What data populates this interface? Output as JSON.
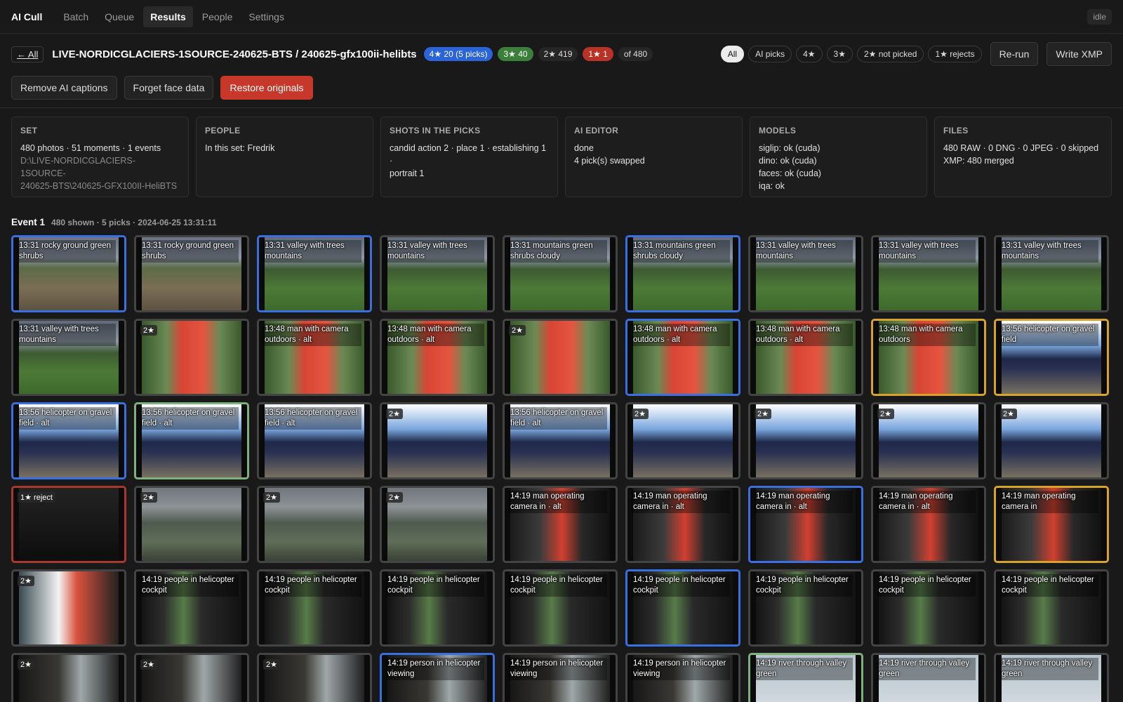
{
  "nav": {
    "brand": "AI Cull",
    "tabs": [
      "Batch",
      "Queue",
      "Results",
      "People",
      "Settings"
    ],
    "active_tab": "Results",
    "status": "idle"
  },
  "header": {
    "back": "← All",
    "title": "LIVE-NORDICGLACIERS-1SOURCE-240625-BTS / 240625-gfx100ii-helibts",
    "counts": {
      "four_star": "4★ 20 (5 picks)",
      "three_star": "3★ 40",
      "two_star": "2★ 419",
      "one_star": "1★ 1",
      "total": "of 480"
    },
    "filters": [
      "All",
      "AI picks",
      "4★",
      "3★",
      "2★ not picked",
      "1★ rejects"
    ],
    "rerun": "Re-run",
    "write_xmp": "Write XMP"
  },
  "actions": {
    "remove_captions": "Remove AI captions",
    "forget_faces": "Forget face data",
    "restore": "Restore originals"
  },
  "panels": [
    {
      "title": "SET",
      "lines": [
        "480 photos · 51 moments · 1 events"
      ],
      "dim_lines": [
        "D:\\LIVE-NORDICGLACIERS-1SOURCE-",
        "240625-BTS\\240625-GFX100II-HeliBTS"
      ]
    },
    {
      "title": "PEOPLE",
      "lines": [
        "In this set: Fredrik"
      ],
      "dim_lines": []
    },
    {
      "title": "SHOTS IN THE PICKS",
      "lines": [
        "candid action 2 · place 1 · establishing 1 ·",
        "portrait 1"
      ],
      "dim_lines": []
    },
    {
      "title": "AI EDITOR",
      "lines": [
        "done",
        "4 pick(s) swapped"
      ],
      "dim_lines": []
    },
    {
      "title": "MODELS",
      "lines": [
        "siglip: ok (cuda)",
        "dino: ok (cuda)",
        "faces: ok (cuda)",
        "iqa: ok"
      ],
      "dim_lines": []
    },
    {
      "title": "FILES",
      "lines": [
        "480 RAW · 0 DNG · 0 JPEG · 0 skipped",
        "XMP: 480 merged"
      ],
      "dim_lines": []
    }
  ],
  "event": {
    "title": "Event 1",
    "meta": "480 shown · 5 picks · 2024-06-25 13:31:11"
  },
  "thumbnails": [
    {
      "caption": "13:31 rocky ground green shrubs",
      "badge": "",
      "border": "pick",
      "img": "rocky"
    },
    {
      "caption": "13:31 rocky ground green shrubs",
      "badge": "",
      "border": "",
      "img": "rocky"
    },
    {
      "caption": "13:31 valley with trees mountains",
      "badge": "",
      "border": "pick",
      "img": "valley"
    },
    {
      "caption": "13:31 valley with trees mountains",
      "badge": "",
      "border": "",
      "img": "valley"
    },
    {
      "caption": "13:31 mountains green shrubs cloudy",
      "badge": "",
      "border": "",
      "img": "valley"
    },
    {
      "caption": "13:31 mountains green shrubs cloudy",
      "badge": "",
      "border": "pick",
      "img": "valley"
    },
    {
      "caption": "13:31 valley with trees mountains",
      "badge": "",
      "border": "",
      "img": "valley"
    },
    {
      "caption": "13:31 valley with trees mountains",
      "badge": "",
      "border": "",
      "img": "valley"
    },
    {
      "caption": "13:31 valley with trees mountains",
      "badge": "",
      "border": "",
      "img": "valley"
    },
    {
      "caption": "13:31 valley with trees mountains",
      "badge": "",
      "border": "",
      "img": "valley"
    },
    {
      "caption": "",
      "badge": "2★",
      "border": "",
      "img": "man"
    },
    {
      "caption": "13:48 man with camera outdoors · alt",
      "badge": "",
      "border": "",
      "img": "man"
    },
    {
      "caption": "13:48 man with camera outdoors · alt",
      "badge": "",
      "border": "",
      "img": "man"
    },
    {
      "caption": "",
      "badge": "2★",
      "border": "",
      "img": "man"
    },
    {
      "caption": "13:48 man with camera outdoors · alt",
      "badge": "",
      "border": "pick",
      "img": "man"
    },
    {
      "caption": "13:48 man with camera outdoors · alt",
      "badge": "",
      "border": "",
      "img": "man"
    },
    {
      "caption": "13:48 man with camera outdoors",
      "badge": "",
      "border": "gold",
      "img": "man"
    },
    {
      "caption": "13:56 helicopter on gravel field",
      "badge": "",
      "border": "gold",
      "img": "heli"
    },
    {
      "caption": "13:56 helicopter on gravel field · alt",
      "badge": "",
      "border": "pick",
      "img": "heli"
    },
    {
      "caption": "13:56 helicopter on gravel field · alt",
      "badge": "",
      "border": "green",
      "img": "heli"
    },
    {
      "caption": "13:56 helicopter on gravel field · alt",
      "badge": "",
      "border": "",
      "img": "heli"
    },
    {
      "caption": "",
      "badge": "2★",
      "border": "",
      "img": "heli"
    },
    {
      "caption": "13:56 helicopter on gravel field · alt",
      "badge": "",
      "border": "",
      "img": "heli"
    },
    {
      "caption": "",
      "badge": "2★",
      "border": "",
      "img": "heli"
    },
    {
      "caption": "",
      "badge": "2★",
      "border": "",
      "img": "heli"
    },
    {
      "caption": "",
      "badge": "2★",
      "border": "",
      "img": "heli"
    },
    {
      "caption": "",
      "badge": "2★",
      "border": "",
      "img": "heli"
    },
    {
      "caption": "",
      "badge": "1★ reject",
      "border": "red",
      "img": "dark"
    },
    {
      "caption": "",
      "badge": "2★",
      "border": "",
      "img": "aerial"
    },
    {
      "caption": "",
      "badge": "2★",
      "border": "",
      "img": "aerial"
    },
    {
      "caption": "",
      "badge": "2★",
      "border": "",
      "img": "aerial"
    },
    {
      "caption": "14:19 man operating camera in · alt",
      "badge": "",
      "border": "",
      "img": "camop"
    },
    {
      "caption": "14:19 man operating camera in · alt",
      "badge": "",
      "border": "",
      "img": "camop"
    },
    {
      "caption": "14:19 man operating camera in · alt",
      "badge": "",
      "border": "pick",
      "img": "camop"
    },
    {
      "caption": "14:19 man operating camera in · alt",
      "badge": "",
      "border": "",
      "img": "camop"
    },
    {
      "caption": "14:19 man operating camera in",
      "badge": "",
      "border": "gold",
      "img": "camop"
    },
    {
      "caption": "",
      "badge": "2★",
      "border": "",
      "img": "pit2"
    },
    {
      "caption": "14:19 people in helicopter cockpit",
      "badge": "",
      "border": "",
      "img": "cockpit"
    },
    {
      "caption": "14:19 people in helicopter cockpit",
      "badge": "",
      "border": "",
      "img": "cockpit"
    },
    {
      "caption": "14:19 people in helicopter cockpit",
      "badge": "",
      "border": "",
      "img": "cockpit"
    },
    {
      "caption": "14:19 people in helicopter cockpit",
      "badge": "",
      "border": "",
      "img": "cockpit"
    },
    {
      "caption": "14:19 people in helicopter cockpit",
      "badge": "",
      "border": "pick",
      "img": "cockpit"
    },
    {
      "caption": "14:19 people in helicopter cockpit",
      "badge": "",
      "border": "",
      "img": "cockpit"
    },
    {
      "caption": "14:19 people in helicopter cockpit",
      "badge": "",
      "border": "",
      "img": "cockpit"
    },
    {
      "caption": "14:19 people in helicopter cockpit",
      "badge": "",
      "border": "",
      "img": "cockpit"
    },
    {
      "caption": "",
      "badge": "2★",
      "border": "",
      "img": "view"
    },
    {
      "caption": "",
      "badge": "2★",
      "border": "",
      "img": "view"
    },
    {
      "caption": "",
      "badge": "2★",
      "border": "",
      "img": "view"
    },
    {
      "caption": "14:19 person in helicopter viewing",
      "badge": "",
      "border": "pick",
      "img": "view"
    },
    {
      "caption": "14:19 person in helicopter viewing",
      "badge": "",
      "border": "",
      "img": "view"
    },
    {
      "caption": "14:19 person in helicopter viewing",
      "badge": "",
      "border": "",
      "img": "view"
    },
    {
      "caption": "14:19 river through valley green",
      "badge": "",
      "border": "green",
      "img": "river"
    },
    {
      "caption": "14:19 river through valley green",
      "badge": "",
      "border": "",
      "img": "river"
    },
    {
      "caption": "14:19 river through valley green",
      "badge": "",
      "border": "",
      "img": "river"
    }
  ]
}
